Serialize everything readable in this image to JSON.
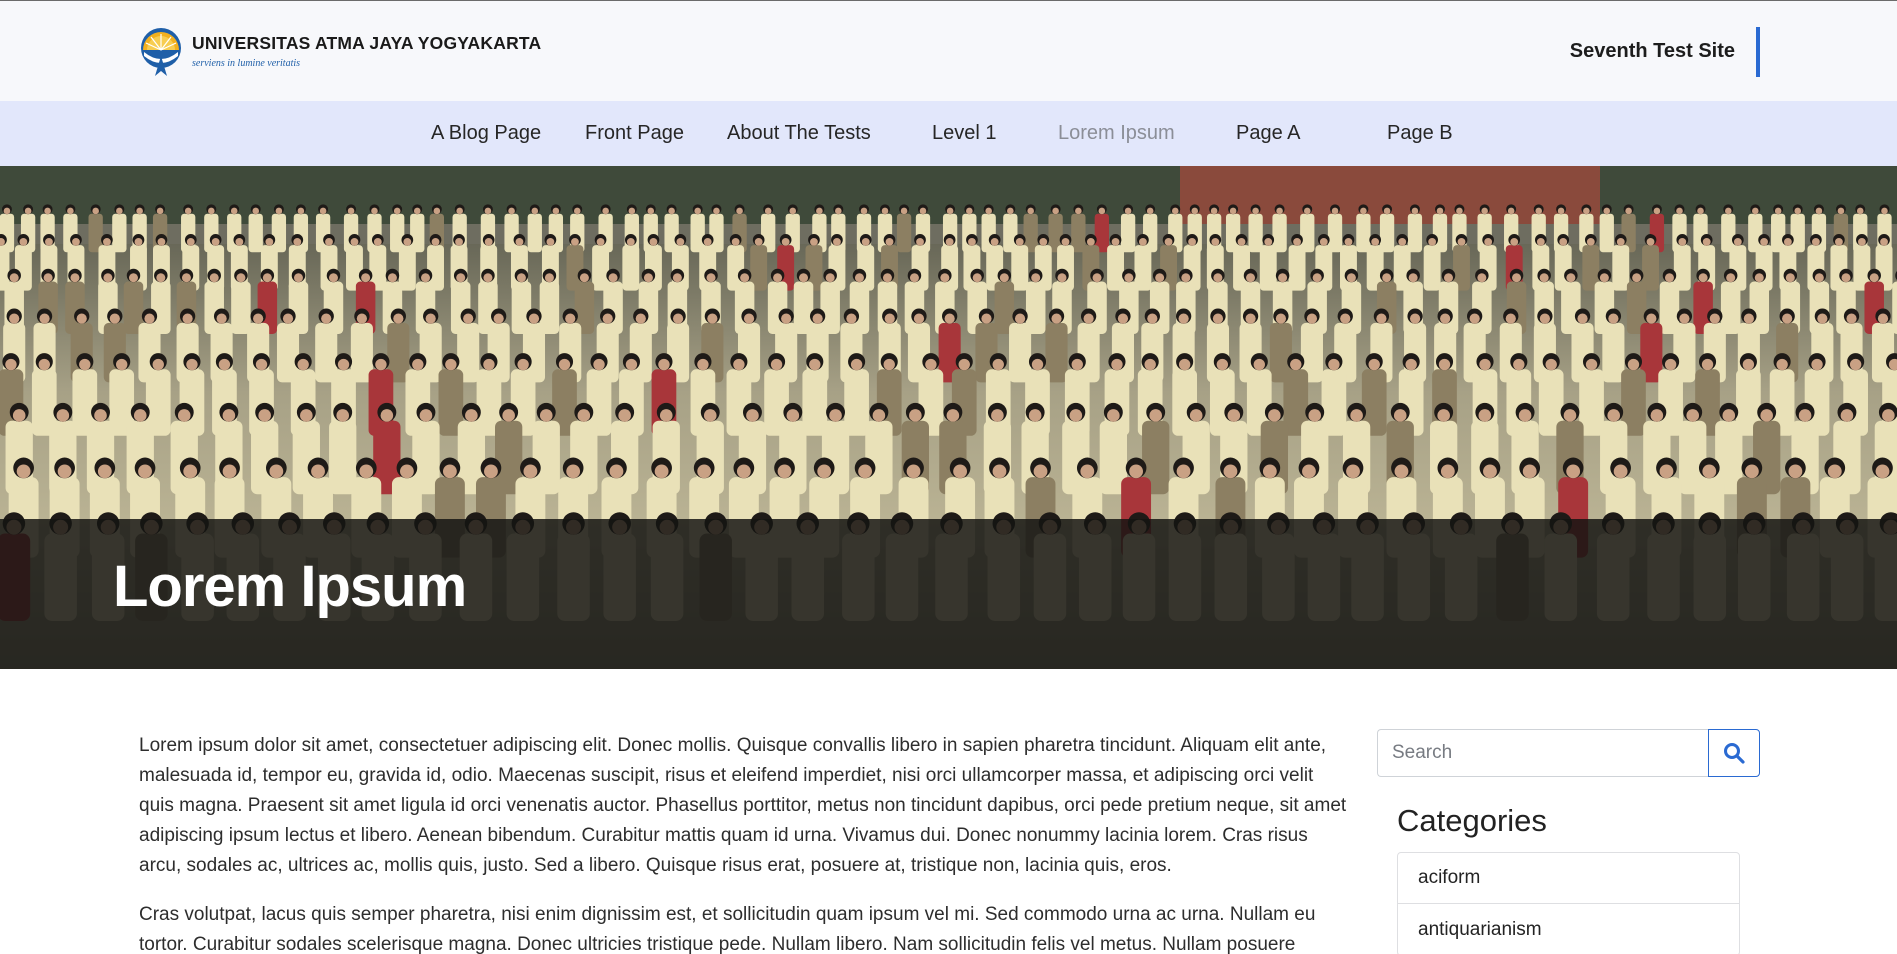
{
  "header": {
    "logo_title": "UNIVERSITAS ATMA JAYA YOGYAKARTA",
    "logo_tagline": "serviens in lumine veritatis",
    "site_name": "Seventh Test Site",
    "accent_color": "#2a6ad2"
  },
  "nav": {
    "items": [
      {
        "label": "A Blog Page"
      },
      {
        "label": "Front Page"
      },
      {
        "label": "About The Tests"
      },
      {
        "label": "Level 1"
      },
      {
        "label": "Lorem Ipsum",
        "active": true
      },
      {
        "label": "Page A"
      },
      {
        "label": "Page B"
      }
    ]
  },
  "hero": {
    "title": "Lorem Ipsum"
  },
  "content": {
    "paragraphs": [
      "Lorem ipsum dolor sit amet, consectetuer adipiscing elit. Donec mollis. Quisque convallis libero in sapien pharetra tincidunt. Aliquam elit ante, malesuada id, tempor eu, gravida id, odio. Maecenas suscipit, risus et eleifend imperdiet, nisi orci ullamcorper massa, et adipiscing orci velit quis magna. Praesent sit amet ligula id orci venenatis auctor. Phasellus porttitor, metus non tincidunt dapibus, orci pede pretium neque, sit amet adipiscing ipsum lectus et libero. Aenean bibendum. Curabitur mattis quam id urna. Vivamus dui. Donec nonummy lacinia lorem. Cras risus arcu, sodales ac, ultrices ac, mollis quis, justo. Sed a libero. Quisque risus erat, posuere at, tristique non, lacinia quis, eros.",
      "Cras volutpat, lacus quis semper pharetra, nisi enim dignissim est, et sollicitudin quam ipsum vel mi. Sed commodo urna ac urna. Nullam eu tortor. Curabitur sodales scelerisque magna. Donec ultricies tristique pede. Nullam libero. Nam sollicitudin felis vel metus. Nullam posuere"
    ]
  },
  "sidebar": {
    "search_placeholder": "Search",
    "search_icon": "search-icon",
    "categories_title": "Categories",
    "categories": [
      "aciform",
      "antiquarianism"
    ]
  }
}
